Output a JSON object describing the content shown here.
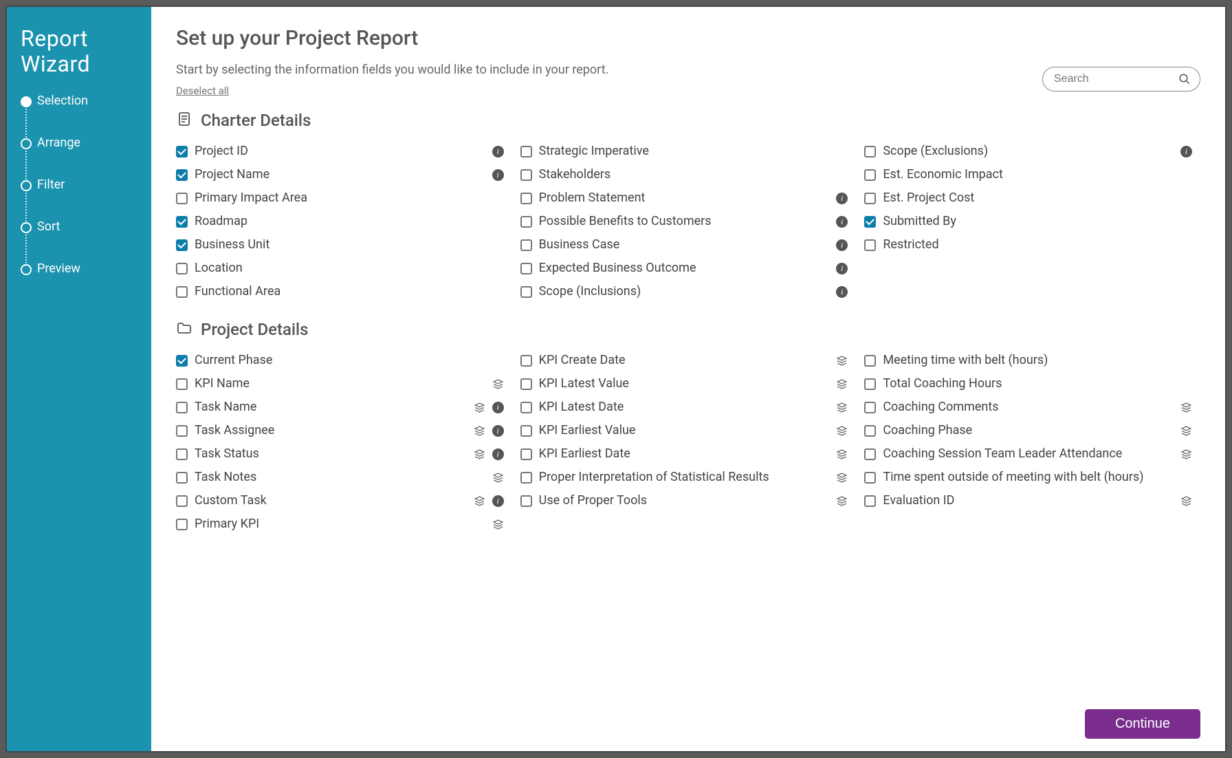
{
  "sidebar": {
    "title": "Report Wizard",
    "steps": [
      {
        "label": "Selection",
        "active": true
      },
      {
        "label": "Arrange",
        "active": false
      },
      {
        "label": "Filter",
        "active": false
      },
      {
        "label": "Sort",
        "active": false
      },
      {
        "label": "Preview",
        "active": false
      }
    ]
  },
  "header": {
    "title": "Set up your Project Report",
    "intro": "Start by selecting the information fields you would like to include in your report.",
    "deselect_label": "Deselect all",
    "search_placeholder": "Search"
  },
  "sections": [
    {
      "title": "Charter Details",
      "icon": "document-icon",
      "columns": [
        [
          {
            "label": "Project ID",
            "checked": true,
            "info": true,
            "stack": false
          },
          {
            "label": "Project Name",
            "checked": true,
            "info": true,
            "stack": false
          },
          {
            "label": "Primary Impact Area",
            "checked": false,
            "info": false,
            "stack": false
          },
          {
            "label": "Roadmap",
            "checked": true,
            "info": false,
            "stack": false
          },
          {
            "label": "Business Unit",
            "checked": true,
            "info": false,
            "stack": false
          },
          {
            "label": "Location",
            "checked": false,
            "info": false,
            "stack": false
          },
          {
            "label": "Functional Area",
            "checked": false,
            "info": false,
            "stack": false
          }
        ],
        [
          {
            "label": "Strategic Imperative",
            "checked": false,
            "info": false,
            "stack": false
          },
          {
            "label": "Stakeholders",
            "checked": false,
            "info": false,
            "stack": false
          },
          {
            "label": "Problem Statement",
            "checked": false,
            "info": true,
            "stack": false
          },
          {
            "label": "Possible Benefits to Customers",
            "checked": false,
            "info": true,
            "stack": false
          },
          {
            "label": "Business Case",
            "checked": false,
            "info": true,
            "stack": false
          },
          {
            "label": "Expected Business Outcome",
            "checked": false,
            "info": true,
            "stack": false
          },
          {
            "label": "Scope (Inclusions)",
            "checked": false,
            "info": true,
            "stack": false
          }
        ],
        [
          {
            "label": "Scope (Exclusions)",
            "checked": false,
            "info": true,
            "stack": false
          },
          {
            "label": "Est. Economic Impact",
            "checked": false,
            "info": false,
            "stack": false
          },
          {
            "label": "Est. Project Cost",
            "checked": false,
            "info": false,
            "stack": false
          },
          {
            "label": "Submitted By",
            "checked": true,
            "info": false,
            "stack": false
          },
          {
            "label": "Restricted",
            "checked": false,
            "info": false,
            "stack": false
          }
        ]
      ]
    },
    {
      "title": "Project Details",
      "icon": "folder-icon",
      "columns": [
        [
          {
            "label": "Current Phase",
            "checked": true,
            "info": false,
            "stack": false
          },
          {
            "label": "KPI Name",
            "checked": false,
            "info": false,
            "stack": true
          },
          {
            "label": "Task Name",
            "checked": false,
            "info": true,
            "stack": true
          },
          {
            "label": "Task Assignee",
            "checked": false,
            "info": true,
            "stack": true
          },
          {
            "label": "Task Status",
            "checked": false,
            "info": true,
            "stack": true
          },
          {
            "label": "Task Notes",
            "checked": false,
            "info": false,
            "stack": true
          },
          {
            "label": "Custom Task",
            "checked": false,
            "info": true,
            "stack": true
          },
          {
            "label": "Primary KPI",
            "checked": false,
            "info": false,
            "stack": true
          }
        ],
        [
          {
            "label": "KPI Create Date",
            "checked": false,
            "info": false,
            "stack": true
          },
          {
            "label": "KPI Latest Value",
            "checked": false,
            "info": false,
            "stack": true
          },
          {
            "label": "KPI Latest Date",
            "checked": false,
            "info": false,
            "stack": true
          },
          {
            "label": "KPI Earliest Value",
            "checked": false,
            "info": false,
            "stack": true
          },
          {
            "label": "KPI Earliest Date",
            "checked": false,
            "info": false,
            "stack": true
          },
          {
            "label": "Proper Interpretation of Statistical Results",
            "checked": false,
            "info": false,
            "stack": true
          },
          {
            "label": "Use of Proper Tools",
            "checked": false,
            "info": false,
            "stack": true
          }
        ],
        [
          {
            "label": "Meeting time with belt (hours)",
            "checked": false,
            "info": false,
            "stack": false
          },
          {
            "label": "Total Coaching Hours",
            "checked": false,
            "info": false,
            "stack": false
          },
          {
            "label": "Coaching Comments",
            "checked": false,
            "info": false,
            "stack": true
          },
          {
            "label": "Coaching Phase",
            "checked": false,
            "info": false,
            "stack": true
          },
          {
            "label": "Coaching Session Team Leader Attendance",
            "checked": false,
            "info": false,
            "stack": true
          },
          {
            "label": "Time spent outside of meeting with belt (hours)",
            "checked": false,
            "info": false,
            "stack": false
          },
          {
            "label": "Evaluation ID",
            "checked": false,
            "info": false,
            "stack": true
          }
        ]
      ]
    }
  ],
  "footer": {
    "continue_label": "Continue"
  }
}
